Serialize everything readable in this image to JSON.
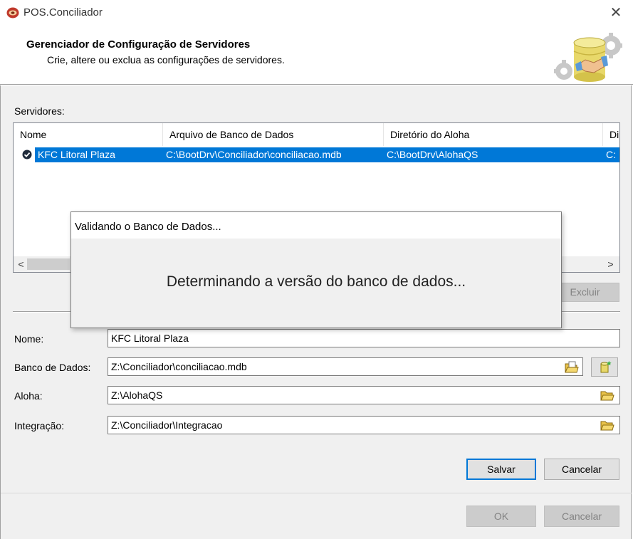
{
  "window": {
    "title": "POS.Conciliador",
    "close_symbol": "✕"
  },
  "header": {
    "title": "Gerenciador de Configuração de Servidores",
    "subtitle": "Crie, altere ou exclua as configurações de servidores."
  },
  "servers": {
    "label": "Servidores:",
    "columns": [
      "Nome",
      "Arquivo de Banco de Dados",
      "Diretório do Aloha",
      "Di"
    ],
    "rows": [
      {
        "nome": "KFC Litoral Plaza",
        "arquivo": "C:\\BootDrv\\Conciliador\\conciliacao.mdb",
        "diretorio": "C:\\BootDrv\\AlohaQS",
        "extra": "C:"
      }
    ],
    "scroll_left": "<",
    "scroll_right": ">",
    "delete_button": "Excluir"
  },
  "form": {
    "nome_label": "Nome:",
    "nome_value": "KFC Litoral Plaza",
    "banco_label": "Banco de Dados:",
    "banco_value": "Z:\\Conciliador\\conciliacao.mdb",
    "aloha_label": "Aloha:",
    "aloha_value": "Z:\\AlohaQS",
    "integracao_label": "Integração:",
    "integracao_value": "Z:\\Conciliador\\Integracao",
    "save_button": "Salvar",
    "cancel_button": "Cancelar"
  },
  "footer": {
    "ok_button": "OK",
    "cancel_button": "Cancelar"
  },
  "progress_dialog": {
    "title": "Validando o Banco de Dados...",
    "message": "Determinando a versão do banco de dados..."
  },
  "colors": {
    "selection": "#0078d7",
    "dialog_bg": "#f0f0f0"
  }
}
